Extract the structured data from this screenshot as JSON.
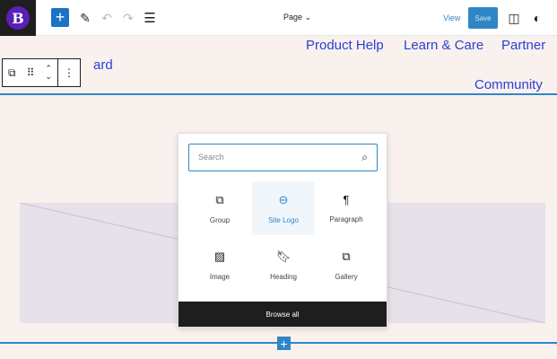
{
  "topbar": {
    "logo_letter": "B",
    "page_label": "Page",
    "view_label": "View",
    "save_label": "Save"
  },
  "nav": {
    "items": [
      "Product Help",
      "Learn & Care",
      "Partner",
      "Community"
    ],
    "partial": "ard"
  },
  "inserter": {
    "search_placeholder": "Search",
    "blocks": [
      {
        "label": "Group",
        "icon": "group-icon"
      },
      {
        "label": "Site Logo",
        "icon": "site-logo-icon"
      },
      {
        "label": "Paragraph",
        "icon": "paragraph-icon"
      },
      {
        "label": "Image",
        "icon": "image-icon"
      },
      {
        "label": "Heading",
        "icon": "heading-icon"
      },
      {
        "label": "Gallery",
        "icon": "gallery-icon"
      }
    ],
    "browse_all": "Browse all"
  }
}
